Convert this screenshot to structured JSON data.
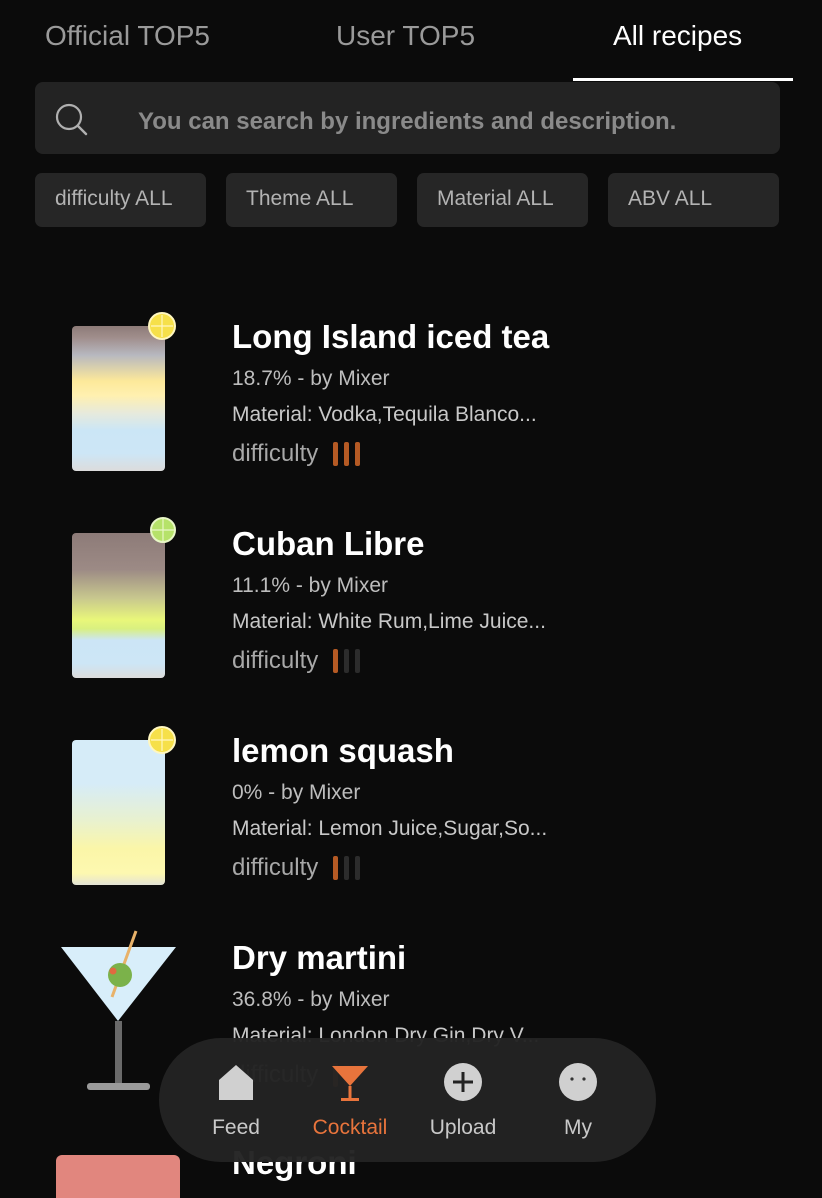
{
  "tabs": [
    {
      "label": "Official TOP5"
    },
    {
      "label": "User TOP5"
    },
    {
      "label": "All recipes"
    }
  ],
  "search": {
    "placeholder": "You can search by ingredients and description."
  },
  "filters": [
    {
      "label": "difficulty  ALL"
    },
    {
      "label": "Theme  ALL"
    },
    {
      "label": "Material  ALL"
    },
    {
      "label": "ABV  ALL"
    }
  ],
  "recipes": [
    {
      "name": "Long Island iced tea",
      "abv_author": "18.7%  - by Mixer",
      "material": "Material: Vodka,Tequila Blanco...",
      "difficulty_label": "difficulty",
      "difficulty_level": 3
    },
    {
      "name": "Cuban Libre",
      "abv_author": "11.1%  - by Mixer",
      "material": "Material: White Rum,Lime Juice...",
      "difficulty_label": "difficulty",
      "difficulty_level": 1
    },
    {
      "name": "lemon squash",
      "abv_author": "0%  - by Mixer",
      "material": "Material: Lemon Juice,Sugar,So...",
      "difficulty_label": "difficulty",
      "difficulty_level": 1
    },
    {
      "name": "Dry martini",
      "abv_author": "36.8%  - by Mixer",
      "material": "Material: London Dry Gin,Dry V...",
      "difficulty_label": "difficulty",
      "difficulty_level": 1
    },
    {
      "name": "Negroni"
    }
  ],
  "nav": [
    {
      "label": "Feed",
      "icon": "home-icon"
    },
    {
      "label": "Cocktail",
      "icon": "cocktail-icon"
    },
    {
      "label": "Upload",
      "icon": "plus-circle-icon"
    },
    {
      "label": "My",
      "icon": "face-icon"
    }
  ],
  "colors": {
    "accent": "#e8743c",
    "difficulty_on": "#b55a24",
    "background": "#0b0b0b"
  }
}
